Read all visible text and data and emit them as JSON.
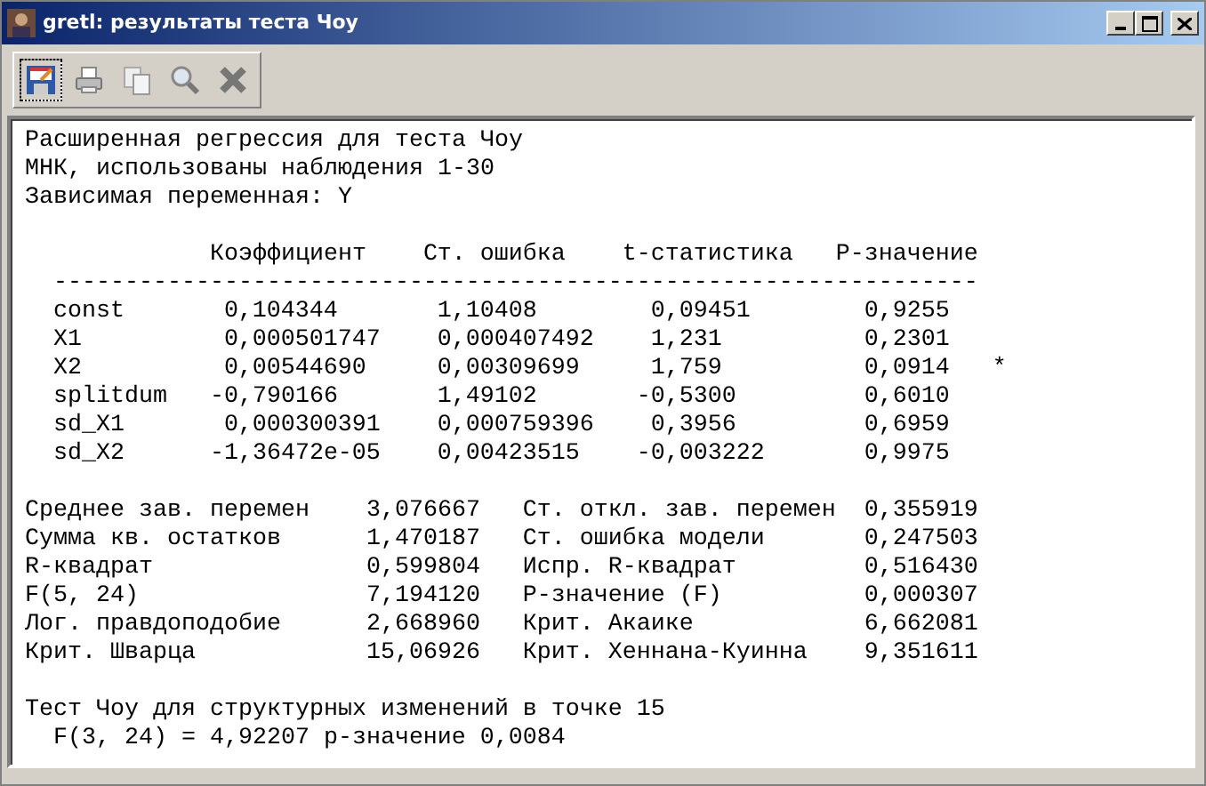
{
  "window": {
    "title": "gretl: результаты теста Чоу"
  },
  "intro": [
    "Расширенная регрессия для теста Чоу",
    "МНК, использованы наблюдения 1-30",
    "Зависимая переменная: Y"
  ],
  "table": {
    "columns": [
      "Коэффициент",
      "Ст. ошибка",
      "t-статистика",
      "P-значение"
    ],
    "separator": "-----------------------------------------------------------------",
    "rows": [
      {
        "name": "const",
        "coef": "0,104344",
        "se": "1,10408",
        "t": "0,09451",
        "p": "0,9255"
      },
      {
        "name": "X1",
        "coef": "0,000501747",
        "se": "0,000407492",
        "t": "1,231",
        "p": "0,2301"
      },
      {
        "name": "X2",
        "coef": "0,00544690",
        "se": "0,00309699",
        "t": "1,759",
        "p": "0,0914",
        "mark": "*"
      },
      {
        "name": "splitdum",
        "coef": "-0,790166",
        "se": "1,49102",
        "t": "-0,5300",
        "p": "0,6010"
      },
      {
        "name": "sd_X1",
        "coef": "0,000300391",
        "se": "0,000759396",
        "t": "0,3956",
        "p": "0,6959"
      },
      {
        "name": "sd_X2",
        "coef": "-1,36472e-05",
        "se": "0,00423515",
        "t": "-0,003222",
        "p": "0,9975"
      }
    ]
  },
  "stats": [
    {
      "label": "Среднее зав. перемен",
      "value": "3,076667",
      "label2": "Ст. откл. зав. перемен",
      "value2": "0,355919"
    },
    {
      "label": "Сумма кв. остатков",
      "value": "1,470187",
      "label2": "Ст. ошибка модели",
      "value2": "0,247503"
    },
    {
      "label": "R-квадрат",
      "value": "0,599804",
      "label2": "Испр. R-квадрат",
      "value2": "0,516430"
    },
    {
      "label": "F(5, 24)",
      "value": "7,194120",
      "label2": "P-значение (F)",
      "value2": "0,000307"
    },
    {
      "label": "Лог. правдоподобие",
      "value": "2,668960",
      "label2": "Крит. Акаике",
      "value2": "6,662081"
    },
    {
      "label": "Крит. Шварца",
      "value": "15,06926",
      "label2": "Крит. Хеннана-Куинна",
      "value2": "9,351611"
    }
  ],
  "chow": {
    "title": "Тест Чоу для структурных изменений в точке 15",
    "result": "F(3, 24) = 4,92207 p-значение 0,0084"
  }
}
